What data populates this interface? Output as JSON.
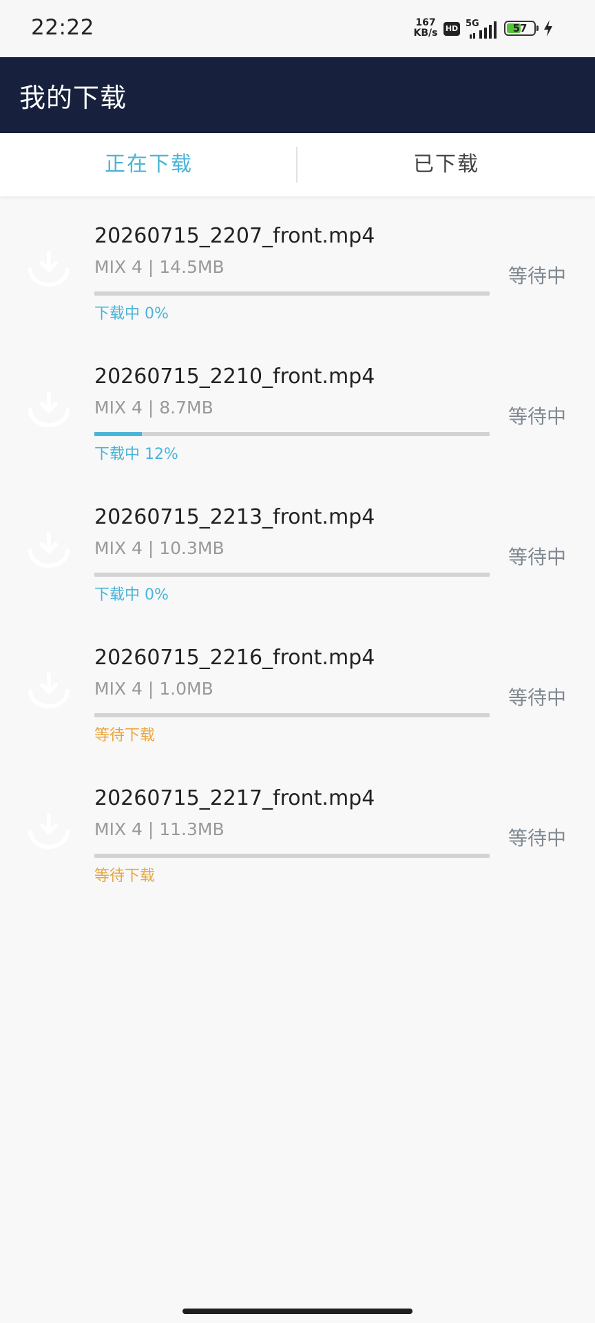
{
  "status_bar": {
    "time": "22:22",
    "net_speed_value": "167",
    "net_speed_unit": "KB/s",
    "hd_label": "HD",
    "network_type": "5G",
    "battery_level": 57,
    "battery_text": "57"
  },
  "app_bar": {
    "title": "我的下载"
  },
  "tabs": [
    {
      "label": "正在下载",
      "active": true
    },
    {
      "label": "已下载",
      "active": false
    }
  ],
  "downloads": [
    {
      "name": "20260715_2207_front.mp4",
      "meta": "MIX 4 | 14.5MB",
      "progress": 0,
      "status": "下载中 0%",
      "status_type": "downloading",
      "queue_state": "等待中"
    },
    {
      "name": "20260715_2210_front.mp4",
      "meta": "MIX 4 | 8.7MB",
      "progress": 12,
      "status": "下载中 12%",
      "status_type": "downloading",
      "queue_state": "等待中"
    },
    {
      "name": "20260715_2213_front.mp4",
      "meta": "MIX 4 | 10.3MB",
      "progress": 0,
      "status": "下载中 0%",
      "status_type": "downloading",
      "queue_state": "等待中"
    },
    {
      "name": "20260715_2216_front.mp4",
      "meta": "MIX 4 | 1.0MB",
      "progress": 0,
      "status": "等待下载",
      "status_type": "waiting",
      "queue_state": "等待中"
    },
    {
      "name": "20260715_2217_front.mp4",
      "meta": "MIX 4 | 11.3MB",
      "progress": 0,
      "status": "等待下载",
      "status_type": "waiting",
      "queue_state": "等待中"
    }
  ],
  "icons": {
    "download_item": "download-icon",
    "signal": "signal-icon",
    "battery": "battery-icon",
    "charging": "charging-bolt-icon"
  },
  "colors": {
    "app_bar": "#17213d",
    "accent": "#4ab4d8",
    "waiting": "#eaa53a"
  }
}
